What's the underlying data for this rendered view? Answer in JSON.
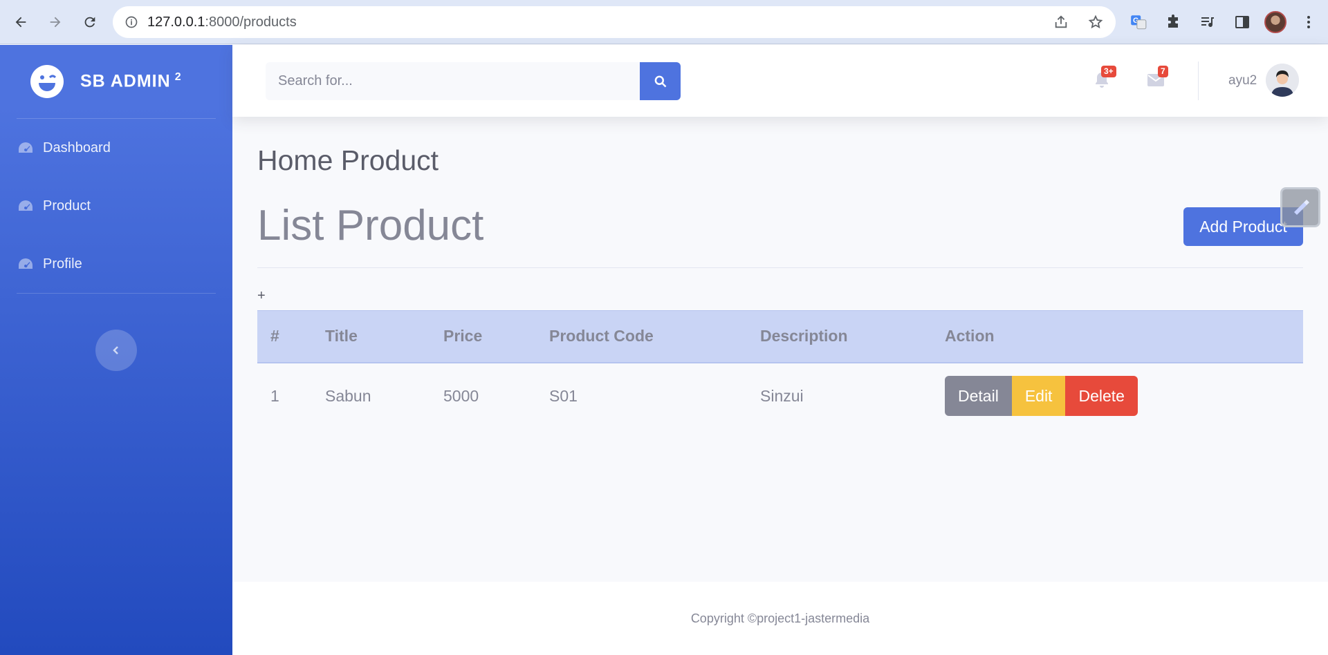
{
  "browser": {
    "url_host": "127.0.0.1",
    "url_path": ":8000/products",
    "icons": [
      "back-arrow-icon",
      "forward-arrow-icon",
      "reload-icon",
      "info-icon",
      "share-icon",
      "star-icon",
      "translate-icon",
      "extensions-icon",
      "media-icon",
      "side-panel-icon",
      "profile-avatar",
      "menu-icon"
    ]
  },
  "sidebar": {
    "brand": "SB ADMIN",
    "brand_sup": "2",
    "items": [
      {
        "label": "Dashboard",
        "icon": "tachometer-icon"
      },
      {
        "label": "Product",
        "icon": "tachometer-icon"
      },
      {
        "label": "Profile",
        "icon": "tachometer-icon"
      }
    ]
  },
  "topbar": {
    "search_placeholder": "Search for...",
    "alerts_count": "3+",
    "messages_count": "7",
    "username": "ayu2"
  },
  "content": {
    "page_heading": "Home Product",
    "list_title": "List Product",
    "add_button": "Add Product",
    "plus": "+",
    "table": {
      "headers": [
        "#",
        "Title",
        "Price",
        "Product Code",
        "Description",
        "Action"
      ],
      "rows": [
        {
          "no": "1",
          "title": "Sabun",
          "price": "5000",
          "code": "S01",
          "description": "Sinzui"
        }
      ],
      "actions": {
        "detail": "Detail",
        "edit": "Edit",
        "delete": "Delete"
      }
    }
  },
  "footer": {
    "text": "Copyright ©project1-jastermedia"
  },
  "colors": {
    "primary": "#4e73df",
    "danger": "#e74a3b",
    "warning": "#f6c23e",
    "secondary": "#858796"
  }
}
